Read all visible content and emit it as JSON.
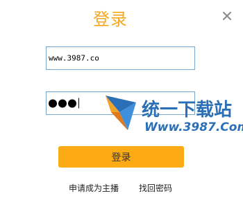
{
  "dialog": {
    "title": "登录",
    "close_icon": "close-icon"
  },
  "form": {
    "account_value": "www.3987.co",
    "password_dot_count": 3,
    "login_button_label": "登录"
  },
  "links": {
    "apply": "申请成为主播",
    "recover": "找回密码"
  },
  "watermark": {
    "title": "统一下载站",
    "url": "Www.3987.Com",
    "logo_icon": "site-logo-icon"
  },
  "colors": {
    "title": "#f5a81e",
    "button": "#fcab15",
    "input_border": "#77a9d1",
    "watermark_blue": "#2b6fb6"
  }
}
